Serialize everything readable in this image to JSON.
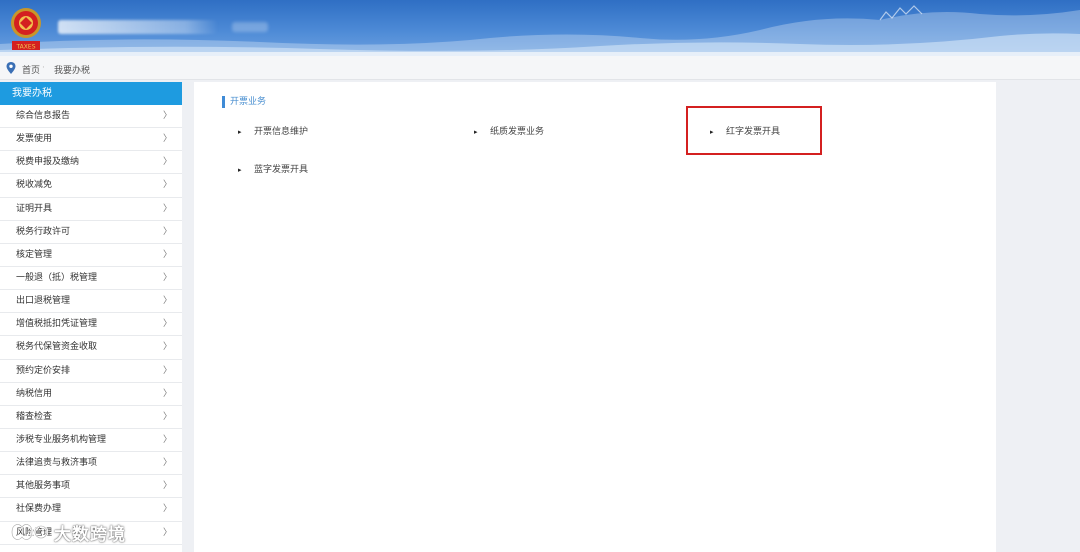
{
  "header": {
    "emblem_icon": "tax-emblem-icon",
    "emblem_caption": "TAXES"
  },
  "breadcrumb": {
    "icon": "location-pin-icon",
    "home": "首页",
    "separator": "·",
    "current": "我要办税"
  },
  "sidebar": {
    "title": "我要办税",
    "items": [
      {
        "label": "综合信息报告"
      },
      {
        "label": "发票使用"
      },
      {
        "label": "税费申报及缴纳"
      },
      {
        "label": "税收减免"
      },
      {
        "label": "证明开具"
      },
      {
        "label": "税务行政许可"
      },
      {
        "label": "核定管理"
      },
      {
        "label": "一般退（抵）税管理"
      },
      {
        "label": "出口退税管理"
      },
      {
        "label": "增值税抵扣凭证管理"
      },
      {
        "label": "税务代保管资金收取"
      },
      {
        "label": "预约定价安排"
      },
      {
        "label": "纳税信用"
      },
      {
        "label": "稽查检查"
      },
      {
        "label": "涉税专业服务机构管理"
      },
      {
        "label": "法律追责与救济事项"
      },
      {
        "label": "其他服务事项"
      },
      {
        "label": "社保费办理"
      },
      {
        "label": "风险管理"
      }
    ],
    "chevron": "〉"
  },
  "main": {
    "section_title": "开票业务",
    "entries": [
      {
        "label": "开票信息维护"
      },
      {
        "label": "纸质发票业务"
      },
      {
        "label": "红字发票开具"
      },
      {
        "label": "蓝字发票开具"
      }
    ],
    "bullet": "▸",
    "highlight_color": "#d42020"
  },
  "watermark": {
    "text": "大数跨境",
    "logo_icon": "watermark-logo-icon"
  },
  "colors": {
    "header_blue": "#2f6fc4",
    "sidebar_active": "#1e9be0",
    "section_accent": "#3f8bd6",
    "highlight_red": "#d42020"
  }
}
